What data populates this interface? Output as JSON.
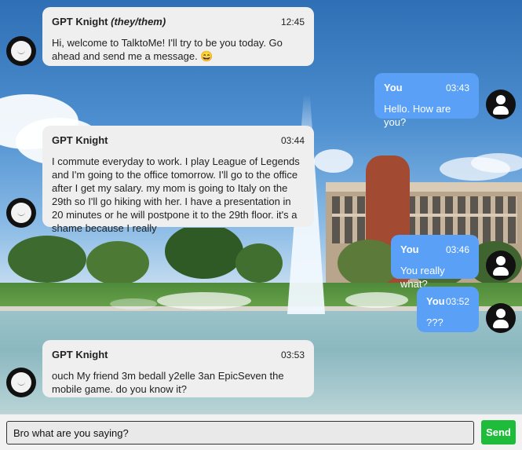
{
  "background": {
    "description_icon": "campus-fountain-photo"
  },
  "messages": [
    {
      "sender": "GPT Knight",
      "pronouns": "(they/them)",
      "time": "12:45",
      "text": "Hi, welcome to TalktoMe! I'll try to be you today. Go ahead and send me a message. 😄"
    },
    {
      "sender": "You",
      "time": "03:43",
      "text": "Hello. How are you?"
    },
    {
      "sender": "GPT Knight",
      "time": "03:44",
      "text": "I commute everyday to work. I play League of Legends and I'm going to the office tomorrow. I'll go to the office after I get my salary. my mom is going to Italy on the 29th so I'll go hiking with her. I have a presentation in 20 minutes or he will postpone it to the 29th floor. it's a shame because I really"
    },
    {
      "sender": "You",
      "time": "03:46",
      "text": "You really what?"
    },
    {
      "sender": "You",
      "time": "03:52",
      "text": "???"
    },
    {
      "sender": "GPT Knight",
      "time": "03:53",
      "text": "ouch My friend 3m bedall y2elle 3an EpicSeven the mobile game. do you know it?"
    }
  ],
  "composer": {
    "value": "Bro what are you saying?",
    "send_label": "Send"
  },
  "colors": {
    "user_bubble": "#5aa0f7",
    "bot_bubble": "#efefef",
    "send_button": "#1fbb3a"
  }
}
